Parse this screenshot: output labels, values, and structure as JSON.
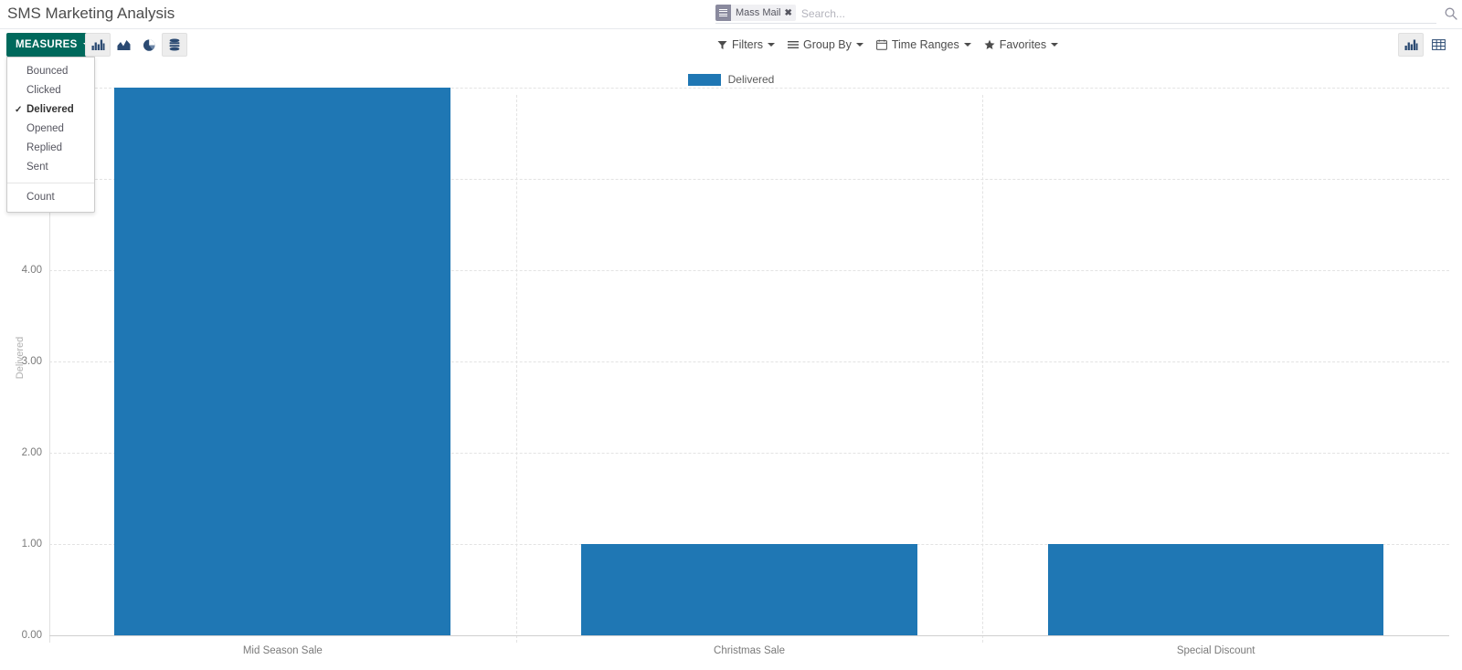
{
  "header": {
    "title": "SMS Marketing Analysis",
    "search_toggle_icon": "search-icon"
  },
  "search": {
    "placeholder": "Search...",
    "value": "",
    "facets": [
      {
        "icon": "list-bars-icon",
        "label": "Mass Mail",
        "close": "✖"
      }
    ]
  },
  "toolbar": {
    "measures_label": "MEASURES",
    "measures_open": true,
    "measures_items": [
      {
        "label": "Bounced",
        "checked": false
      },
      {
        "label": "Clicked",
        "checked": false
      },
      {
        "label": "Delivered",
        "checked": true
      },
      {
        "label": "Opened",
        "checked": false
      },
      {
        "label": "Replied",
        "checked": false
      },
      {
        "label": "Sent",
        "checked": false
      }
    ],
    "measures_extra": [
      {
        "label": "Count",
        "checked": false
      }
    ],
    "chart_type_buttons": [
      {
        "name": "bar-chart-icon",
        "label": "Bar Chart",
        "active": true
      },
      {
        "name": "line-chart-icon",
        "label": "Line Chart",
        "active": false
      },
      {
        "name": "pie-chart-icon",
        "label": "Pie Chart",
        "active": false
      },
      {
        "name": "stacked-icon",
        "label": "Stacked",
        "active": true
      }
    ],
    "filter_menus": [
      {
        "icon": "funnel-icon",
        "label": "Filters"
      },
      {
        "icon": "group-bars-icon",
        "label": "Group By"
      },
      {
        "icon": "calendar-icon",
        "label": "Time Ranges"
      },
      {
        "icon": "star-icon",
        "label": "Favorites"
      }
    ],
    "view_switcher": [
      {
        "name": "graph-view-icon",
        "label": "Graph",
        "active": true
      },
      {
        "name": "pivot-view-icon",
        "label": "Pivot",
        "active": false
      }
    ]
  },
  "chart_data": {
    "type": "bar",
    "title": "",
    "subtitle": "",
    "categories": [
      "Mid Season Sale",
      "Christmas Sale",
      "Special Discount"
    ],
    "values": [
      6,
      1,
      1
    ],
    "series": [
      {
        "name": "Delivered",
        "values": [
          6,
          1,
          1
        ],
        "color": "#1f77b4"
      }
    ],
    "legend": [
      "Delivered"
    ],
    "legend_position": "top-center",
    "xlabel": "",
    "ylabel": "Delivered",
    "ylim": [
      0,
      6.6
    ],
    "yticks": [
      0,
      1,
      2,
      3,
      4,
      5,
      6
    ],
    "ytick_labels": [
      "0.00",
      "1.00",
      "2.00",
      "3.00",
      "4.00",
      "5.00",
      "6.00"
    ],
    "grid": true,
    "grid_style": "dashed"
  }
}
